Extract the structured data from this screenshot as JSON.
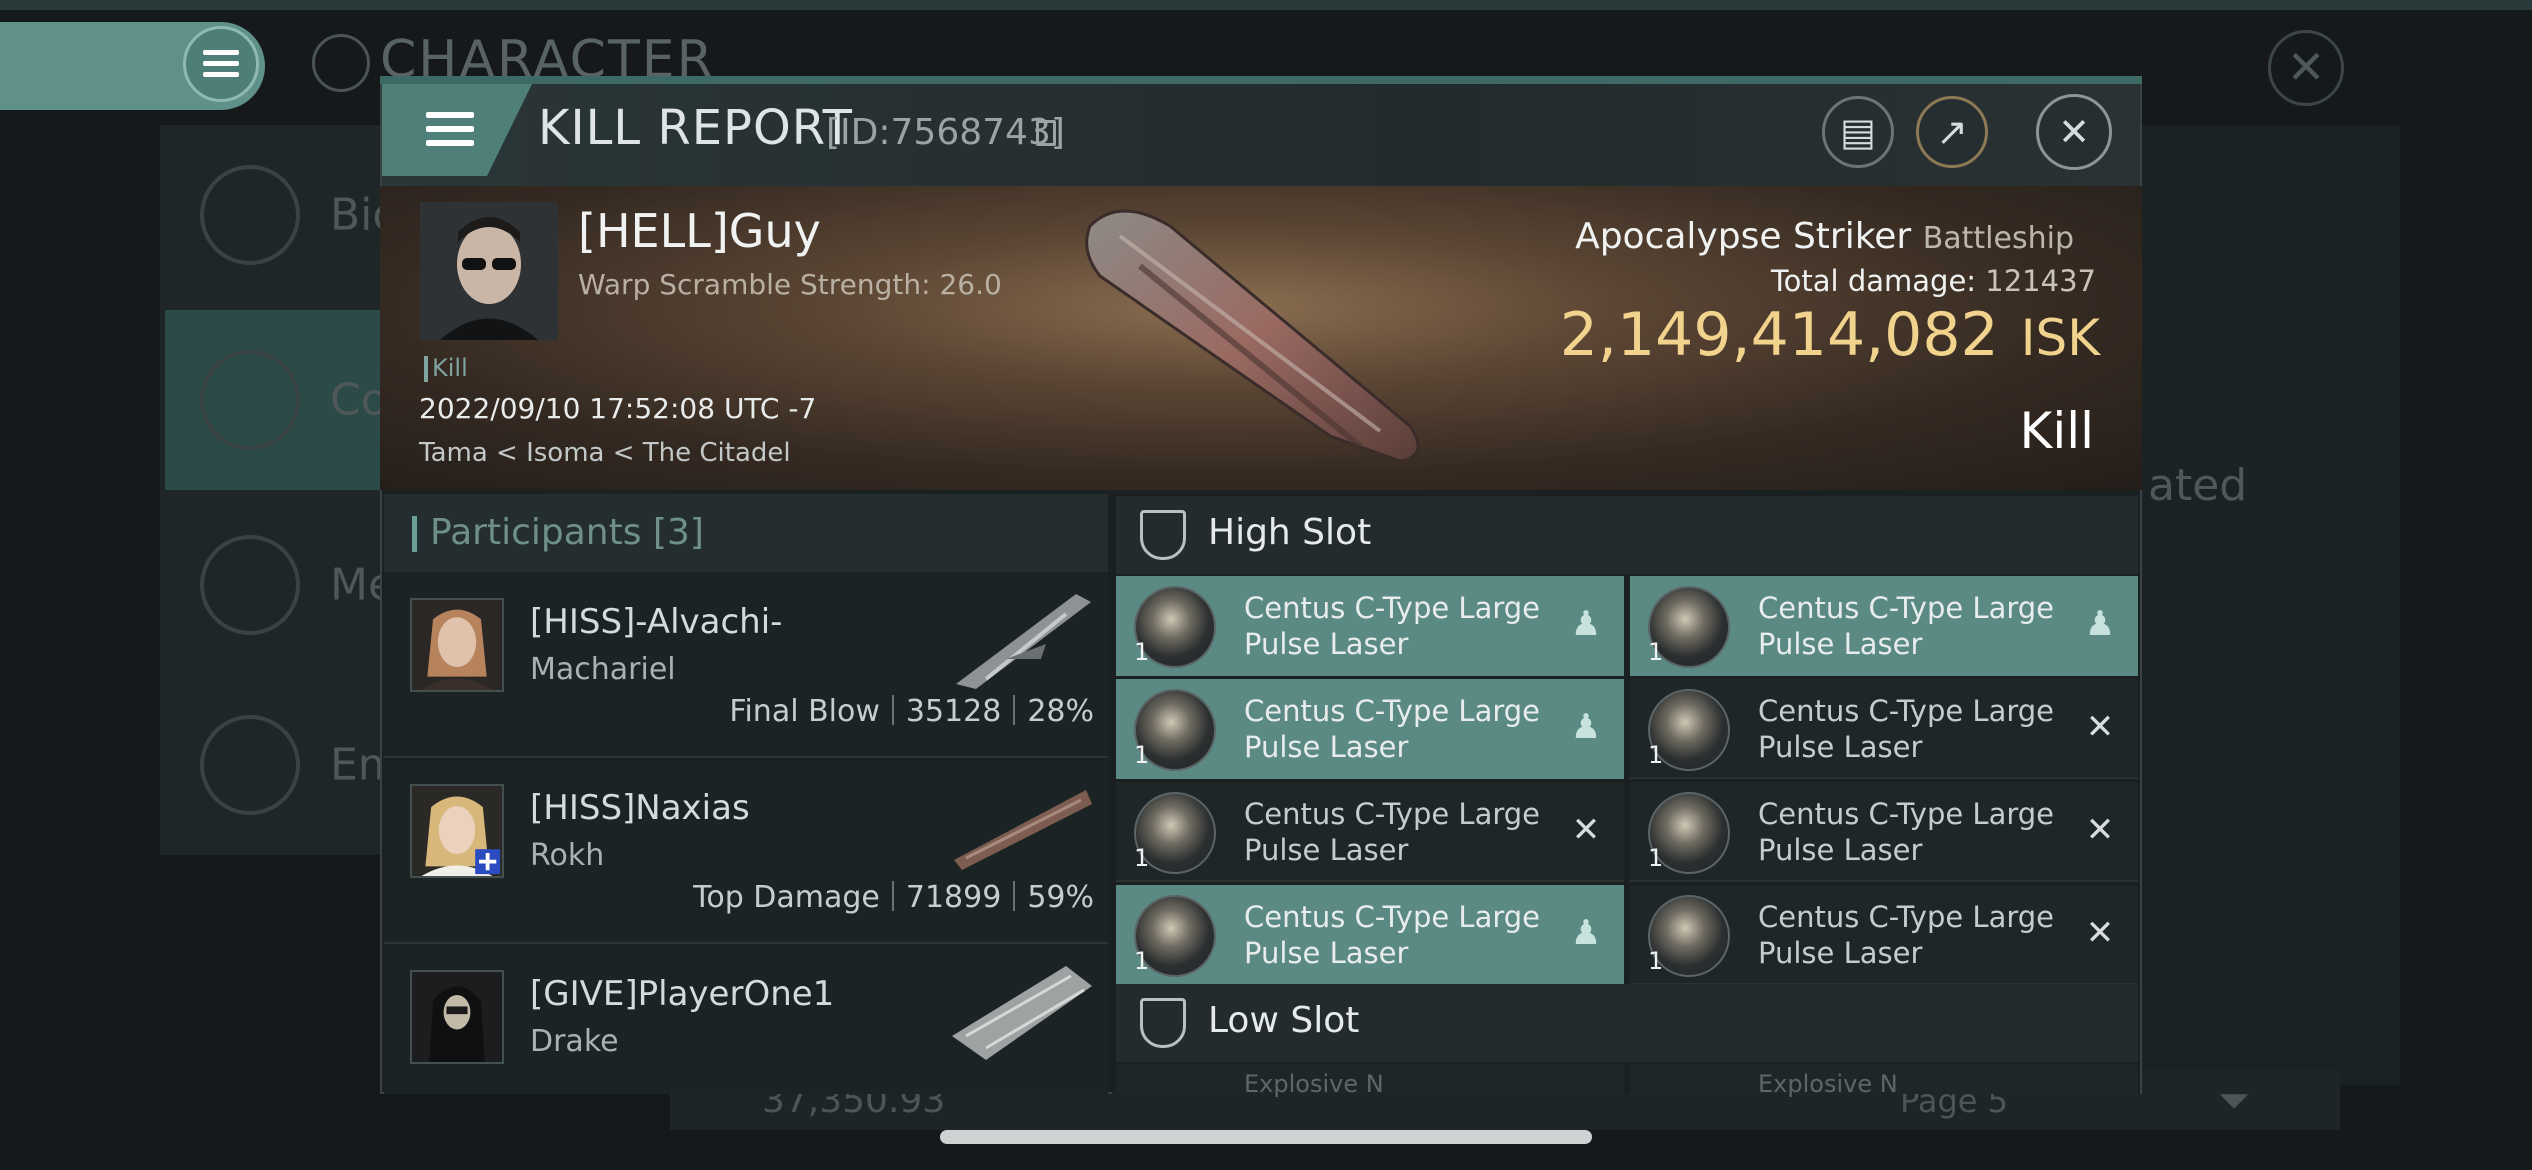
{
  "background": {
    "screen_title": "CHARACTER",
    "sidebar_labels": [
      "Bio",
      "Co",
      "Me",
      "Em"
    ],
    "right_partial_text": "ated",
    "isk_balance": "37,350.93",
    "page_label": "Page 5"
  },
  "modal": {
    "title": "KILL REPORT",
    "report_id": "[ID:7568743]",
    "buttons": [
      "notes-icon",
      "share-icon",
      "close-icon"
    ]
  },
  "victim": {
    "pilot_name": "[HELL]Guy",
    "warp_scramble": "Warp Scramble Strength: 26.0",
    "tag": "Kill",
    "datetime": "2022/09/10 17:52:08 UTC -7",
    "location": "Tama < Isoma < The Citadel",
    "ship_name": "Apocalypse Striker",
    "ship_class": "Battleship",
    "total_damage_label": "Total damage:",
    "total_damage_value": "121437",
    "isk_value": "2,149,414,082",
    "isk_unit": "ISK",
    "result": "Kill"
  },
  "participants": {
    "title": "Participants [3]",
    "rows": [
      {
        "name": "[HISS]-Alvachi-",
        "ship": "Machariel",
        "role": "Final Blow",
        "damage": "35128",
        "percent": "28%"
      },
      {
        "name": "[HISS]Naxias",
        "ship": "Rokh",
        "role": "Top Damage",
        "damage": "71899",
        "percent": "59%"
      },
      {
        "name": "[GIVE]PlayerOne1",
        "ship": "Drake",
        "role": "",
        "damage": "",
        "percent": ""
      }
    ]
  },
  "slots": {
    "high_title": "High Slot",
    "low_title": "Low Slot",
    "high": [
      {
        "name": "Centus C-Type Large Pulse Laser",
        "qty": "1",
        "state": "person-icon",
        "active": true
      },
      {
        "name": "Centus C-Type Large Pulse Laser",
        "qty": "1",
        "state": "person-icon",
        "active": true
      },
      {
        "name": "Centus C-Type Large Pulse Laser",
        "qty": "1",
        "state": "person-icon",
        "active": true
      },
      {
        "name": "Centus C-Type Large Pulse Laser",
        "qty": "1",
        "state": "x-icon",
        "active": false
      },
      {
        "name": "Centus C-Type Large Pulse Laser",
        "qty": "1",
        "state": "x-icon",
        "active": false
      },
      {
        "name": "Centus C-Type Large Pulse Laser",
        "qty": "1",
        "state": "x-icon",
        "active": false
      },
      {
        "name": "Centus C-Type Large Pulse Laser",
        "qty": "1",
        "state": "person-icon",
        "active": true
      },
      {
        "name": "Centus C-Type Large Pulse Laser",
        "qty": "1",
        "state": "x-icon",
        "active": false
      }
    ],
    "low_peek": [
      "Explosive N",
      "Explosive N"
    ]
  },
  "colors": {
    "accent_teal": "#5a8a83",
    "isk_gold": "#f2d38e"
  }
}
